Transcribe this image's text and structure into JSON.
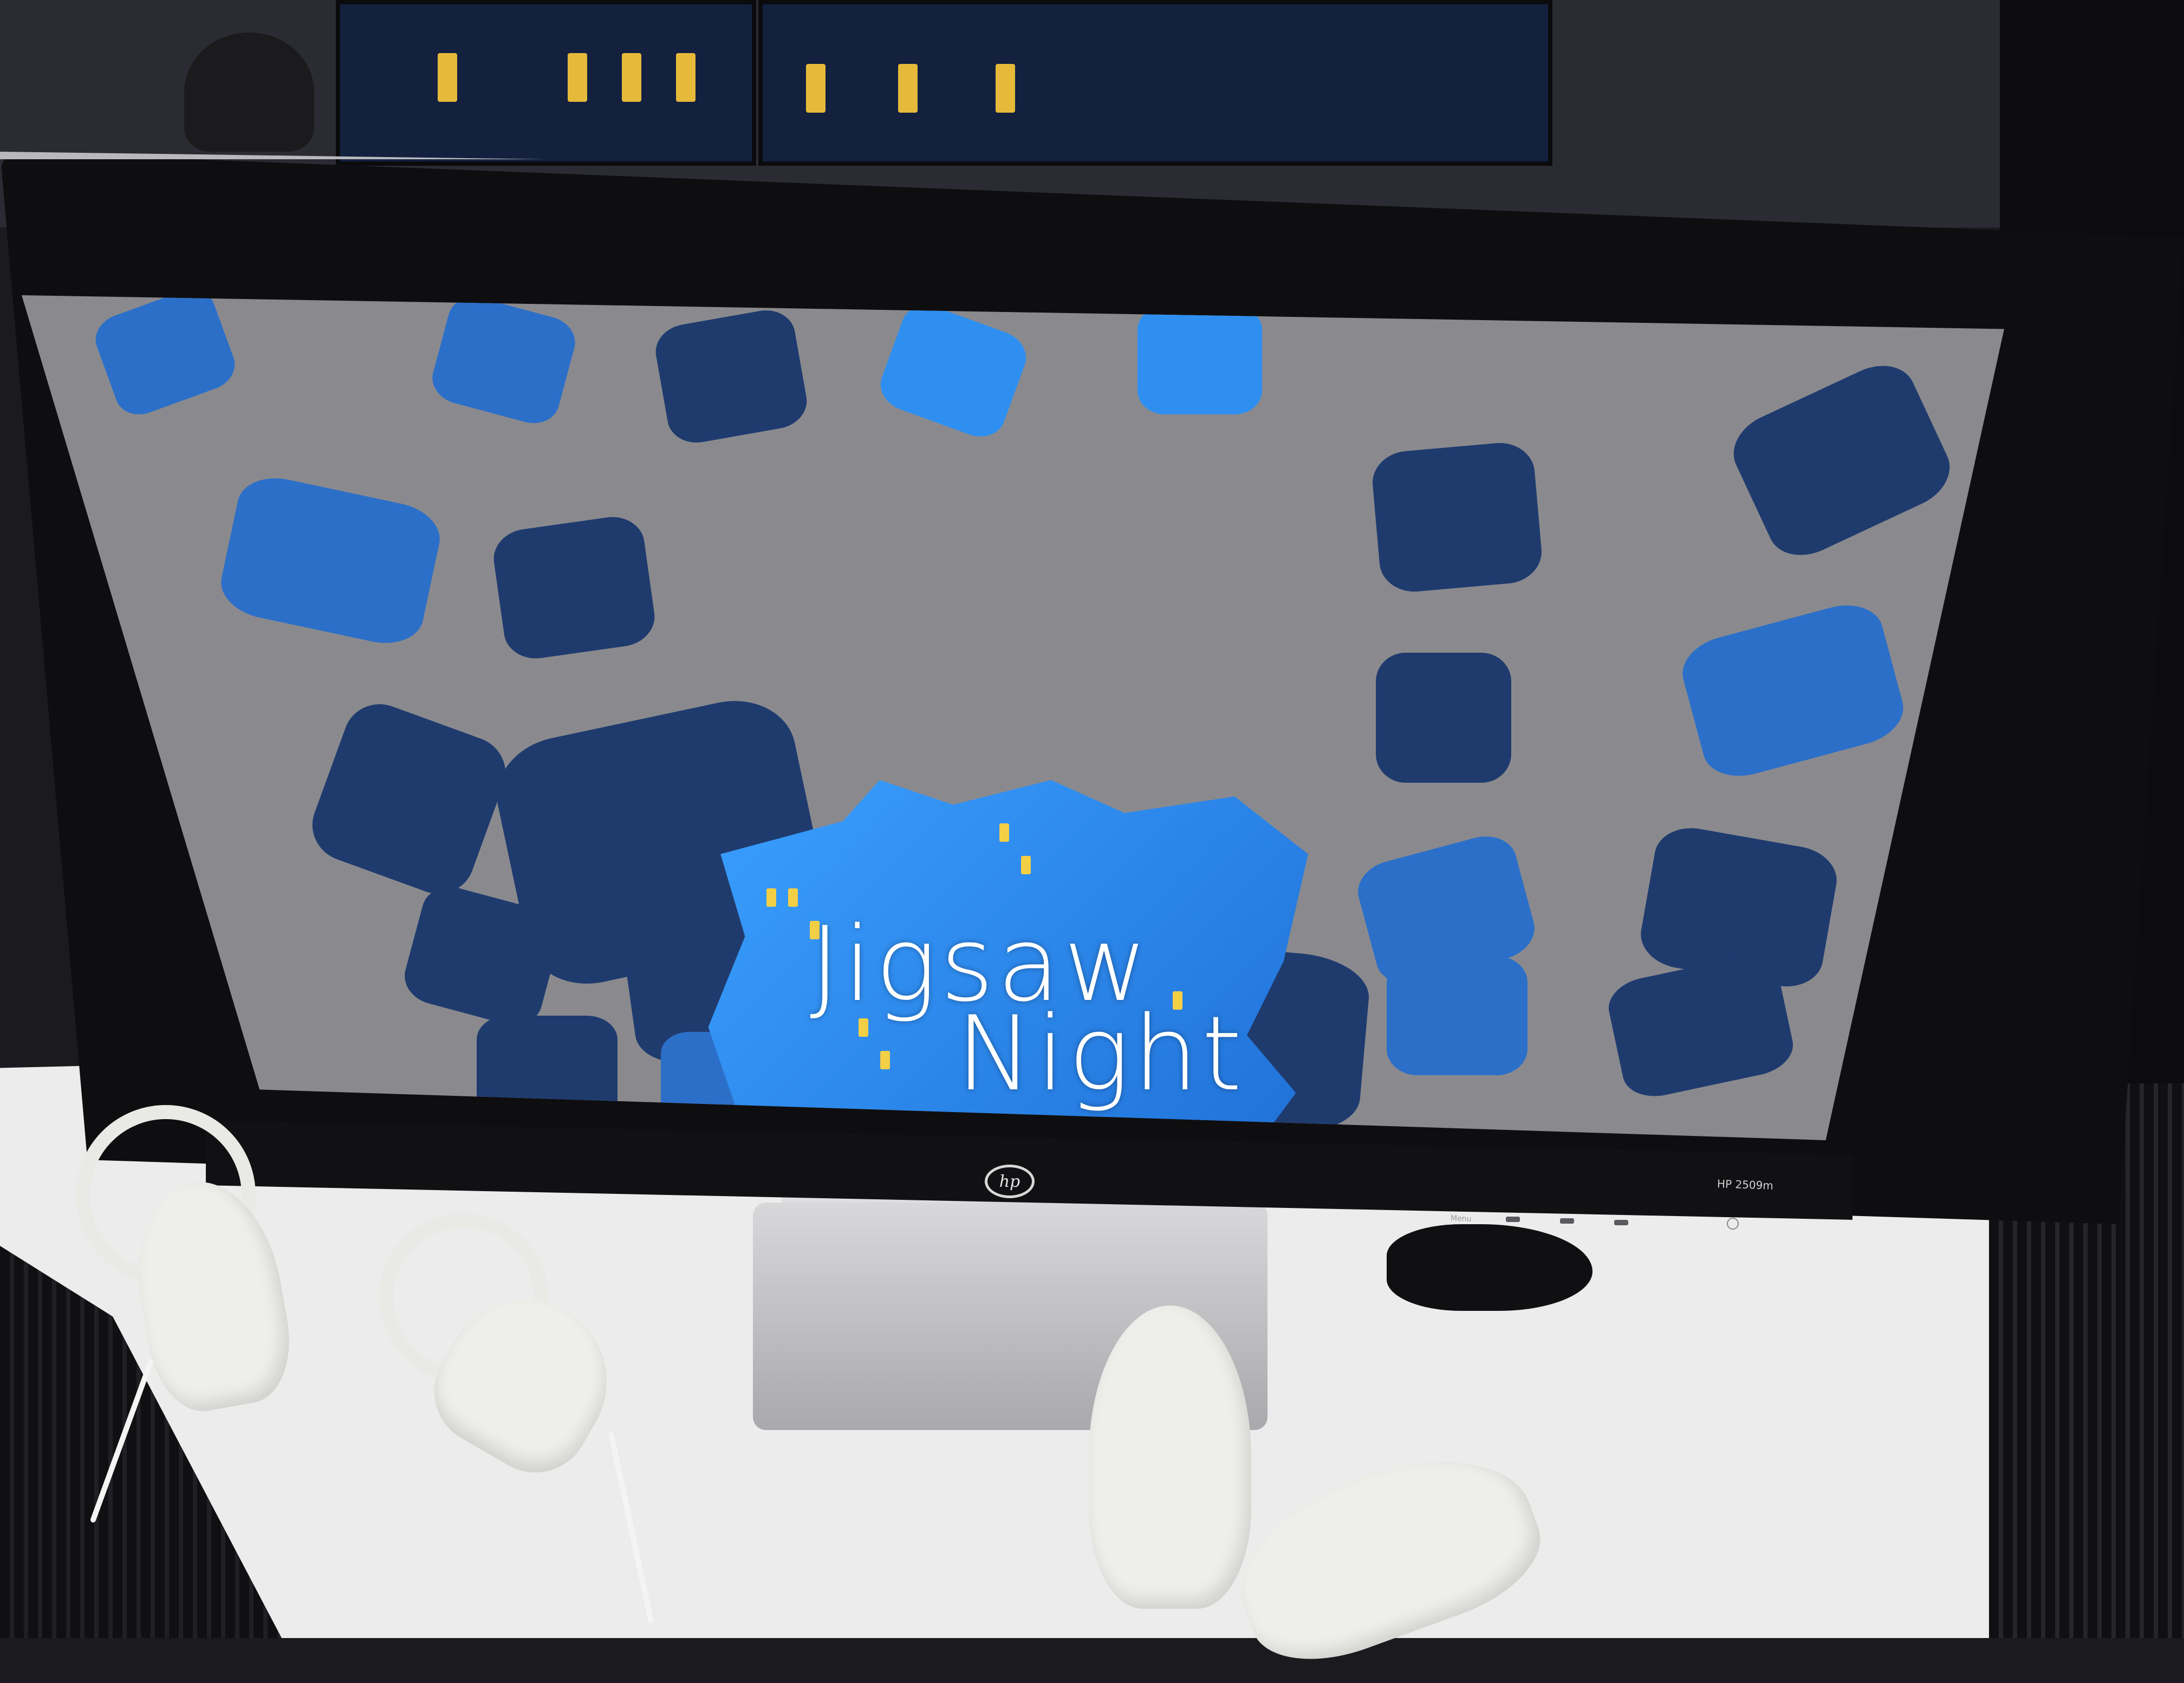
{
  "image_description_text": {
    "monitor_brand": "hp",
    "monitor_model": "HP 2509m",
    "menu_label": "Menu"
  },
  "game": {
    "title_line1": "Jigsaw",
    "title_line2": "Night"
  },
  "colors": {
    "screen_background": "#8a8a8e",
    "piece_dark_blue": "#1f3b6e",
    "piece_mid_blue": "#2c6fc9",
    "piece_light_blue": "#2f8ff0",
    "window_yellow": "#f3cf45",
    "title_text": "#ffffff",
    "controller_white": "#eeeeea",
    "bezel_black": "#0e0e10"
  },
  "icons": {
    "hp_logo": "hp-logo-icon",
    "power_button": "power-icon"
  }
}
